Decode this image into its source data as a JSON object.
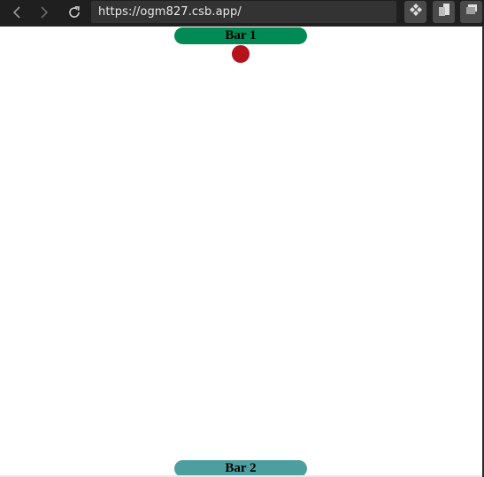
{
  "browser": {
    "url": "https://ogm827.csb.app/",
    "back_icon": "chevron-left-icon",
    "forward_icon": "chevron-right-icon",
    "reload_icon": "reload-icon",
    "extensions": [
      "extension-icon",
      "copy-icon",
      "windows-icon"
    ]
  },
  "game": {
    "bar1": {
      "label": "Bar 1",
      "color": "#008a55"
    },
    "bar2": {
      "label": "Bar 2",
      "color": "#4d9e9e"
    },
    "ball": {
      "color": "#b5121b"
    }
  }
}
